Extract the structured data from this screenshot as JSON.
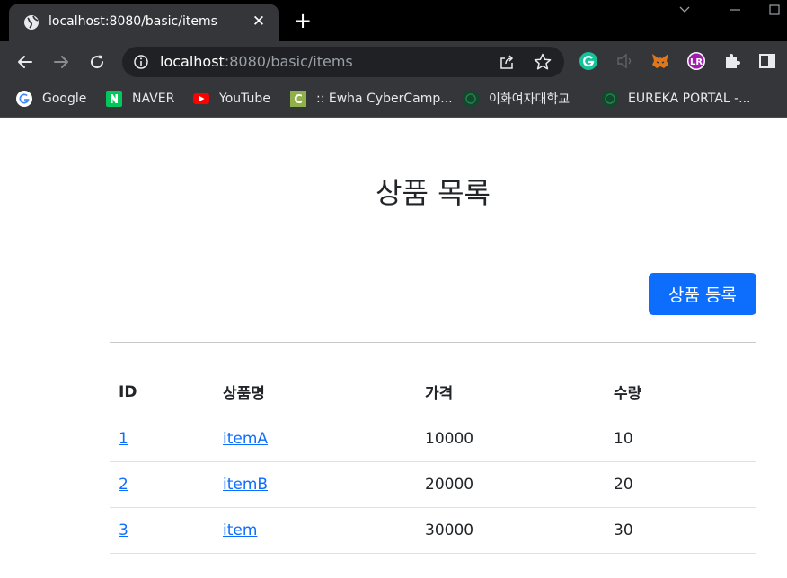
{
  "browser": {
    "tab_title": "localhost:8080/basic/items",
    "url_host": "localhost",
    "url_path": ":8080/basic/items",
    "bookmarks": [
      {
        "label": "Google",
        "icon": "google-icon"
      },
      {
        "label": "NAVER",
        "icon": "naver-icon"
      },
      {
        "label": "YouTube",
        "icon": "youtube-icon"
      },
      {
        "label": ":: Ewha CyberCamp...",
        "icon": "cybercamp-icon"
      },
      {
        "label": "이화여자대학교",
        "icon": "ewha-icon"
      },
      {
        "label": "EUREKA PORTAL -...",
        "icon": "eureka-icon"
      }
    ],
    "extensions": [
      "grammarly-icon",
      "speaker-muted-icon",
      "metamask-icon",
      "profile-lr-icon",
      "puzzle-icon",
      "side-panel-icon"
    ]
  },
  "page": {
    "title": "상품 목록",
    "register_button": "상품 등록",
    "table": {
      "headers": [
        "ID",
        "상품명",
        "가격",
        "수량"
      ],
      "rows": [
        {
          "id": "1",
          "name": "itemA",
          "price": "10000",
          "quantity": "10"
        },
        {
          "id": "2",
          "name": "itemB",
          "price": "20000",
          "quantity": "20"
        },
        {
          "id": "3",
          "name": "item",
          "price": "30000",
          "quantity": "30"
        }
      ]
    }
  },
  "colors": {
    "primary": "#0d6efd",
    "link": "#0d6efd",
    "chrome_dark": "#35363a",
    "tabstrip": "#000000"
  }
}
